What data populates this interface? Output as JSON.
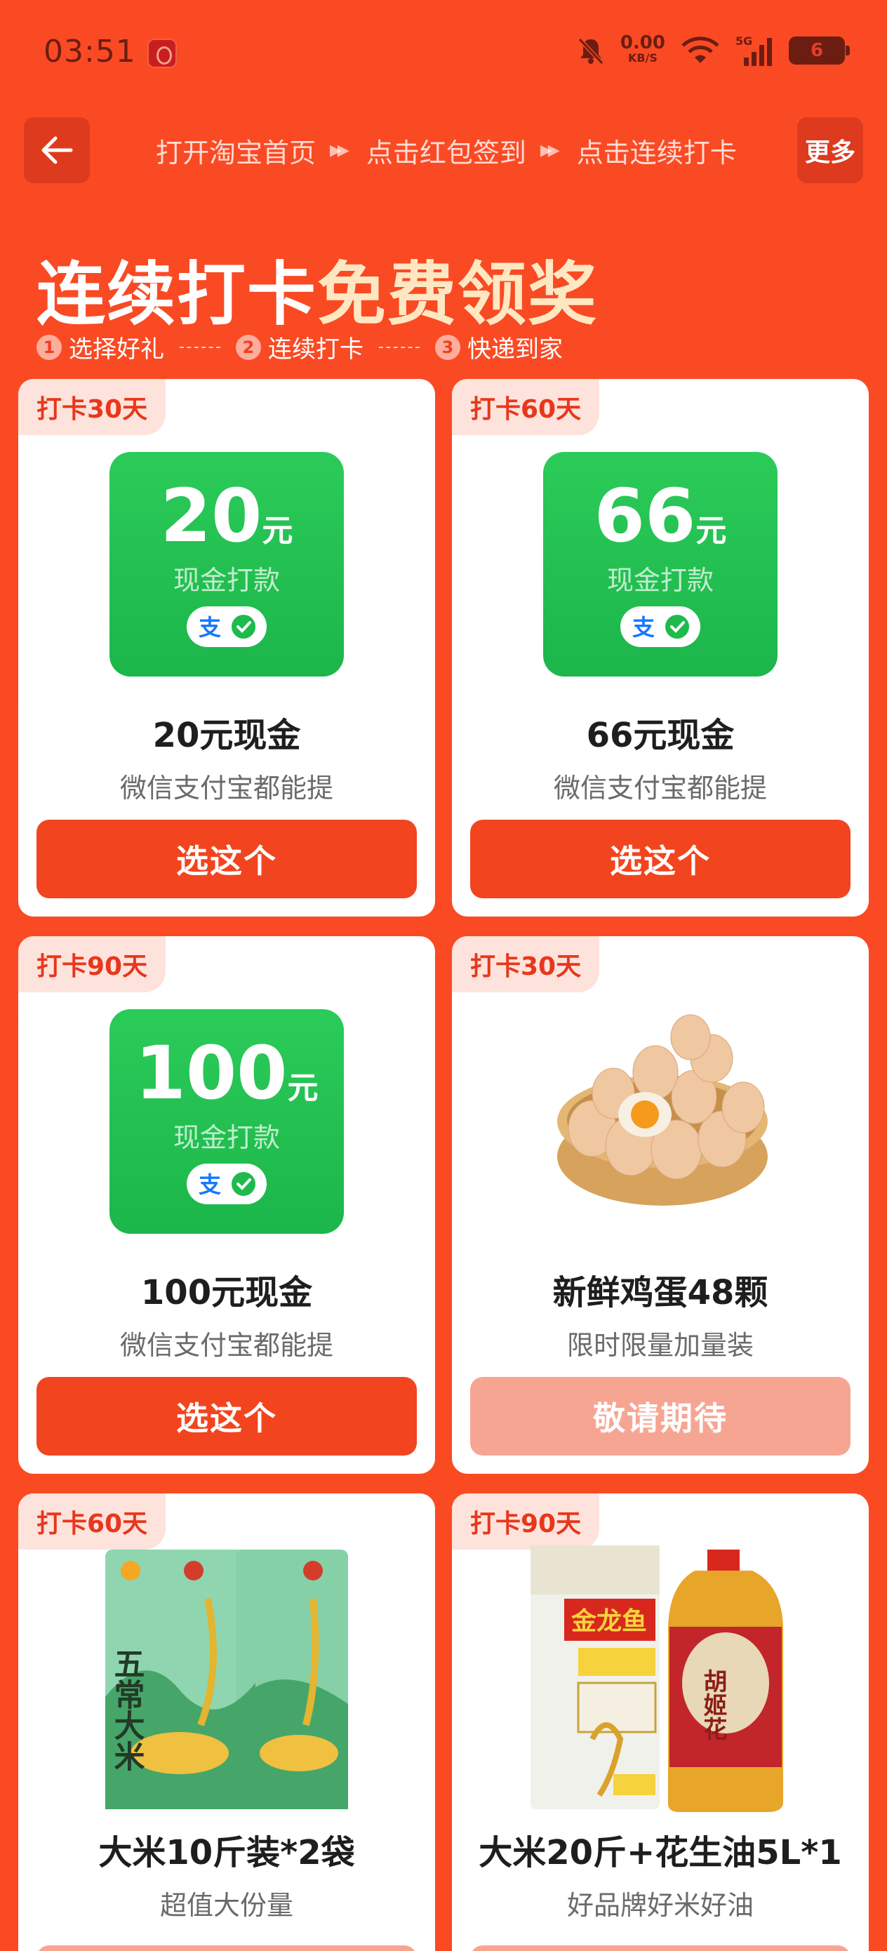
{
  "status": {
    "time": "03:51",
    "net_speed": "0.00",
    "net_unit": "KB/S",
    "battery": "6"
  },
  "nav": {
    "steps": [
      "打开淘宝首页",
      "点击红包签到",
      "点击连续打卡"
    ],
    "more_label": "更多"
  },
  "hero": {
    "title_main": "连续打卡",
    "title_highlight": "免费领奖",
    "steps": [
      {
        "num": "1",
        "label": "选择好礼"
      },
      {
        "num": "2",
        "label": "连续打卡"
      },
      {
        "num": "3",
        "label": "快递到家"
      }
    ]
  },
  "cards": [
    {
      "badge": "打卡30天",
      "type": "cash",
      "amount": "20",
      "unit": "元",
      "cash_sub": "现金打款",
      "title": "20元现金",
      "sub": "微信支付宝都能提",
      "button": "选这个",
      "button_state": "active"
    },
    {
      "badge": "打卡60天",
      "type": "cash",
      "amount": "66",
      "unit": "元",
      "cash_sub": "现金打款",
      "title": "66元现金",
      "sub": "微信支付宝都能提",
      "button": "选这个",
      "button_state": "active"
    },
    {
      "badge": "打卡90天",
      "type": "cash",
      "amount": "100",
      "unit": "元",
      "cash_sub": "现金打款",
      "title": "100元现金",
      "sub": "微信支付宝都能提",
      "button": "选这个",
      "button_state": "active"
    },
    {
      "badge": "打卡30天",
      "type": "eggs",
      "title": "新鲜鸡蛋48颗",
      "sub": "限时限量加量装",
      "button": "敬请期待",
      "button_state": "disabled"
    },
    {
      "badge": "打卡60天",
      "type": "rice",
      "rice_text": "五常大米",
      "title": "大米10斤装*2袋",
      "sub": "超值大份量"
    },
    {
      "badge": "打卡90天",
      "type": "rice-oil",
      "brand_text": "金龙鱼",
      "oil_text": "胡姬花",
      "title": "大米20斤+花生油5L*1",
      "sub": "好品牌好米好油"
    }
  ],
  "colors": {
    "background": "#fa4a22",
    "accent": "#f2451f",
    "highlight": "#ffe7c2",
    "cash_green": "#1fba4d",
    "disabled_button": "#f7a593"
  }
}
